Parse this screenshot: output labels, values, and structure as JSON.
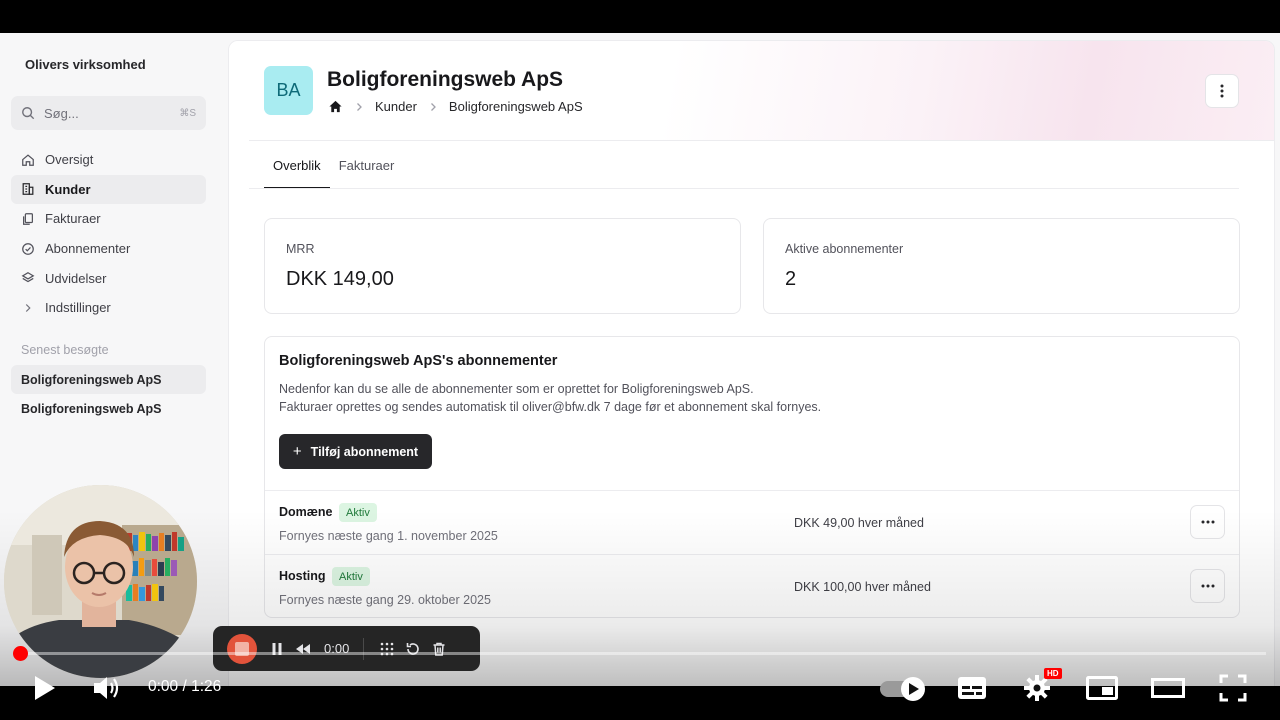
{
  "sidebar": {
    "org_name": "Olivers virksomhed",
    "search_placeholder": "Søg...",
    "search_shortcut": "⌘S",
    "items": [
      {
        "label": "Oversigt",
        "icon": "home-icon"
      },
      {
        "label": "Kunder",
        "icon": "building-icon",
        "active": true
      },
      {
        "label": "Fakturaer",
        "icon": "documents-icon"
      },
      {
        "label": "Abonnementer",
        "icon": "check-circle-icon"
      },
      {
        "label": "Udvidelser",
        "icon": "layers-icon"
      },
      {
        "label": "Indstillinger",
        "icon": "chevron-right-icon"
      }
    ],
    "recent_heading": "Senest besøgte",
    "recent": [
      "Boligforeningsweb ApS",
      "Boligforeningsweb ApS"
    ]
  },
  "header": {
    "avatar_initials": "BA",
    "title": "Boligforeningsweb ApS",
    "breadcrumb": [
      "Kunder",
      "Boligforeningsweb ApS"
    ]
  },
  "tabs": [
    "Overblik",
    "Fakturaer"
  ],
  "stats": {
    "mrr_label": "MRR",
    "mrr_value": "DKK 149,00",
    "active_label": "Aktive abonnementer",
    "active_value": "2"
  },
  "subscriptions": {
    "title": "Boligforeningsweb ApS's abonnementer",
    "desc_line1": "Nedenfor kan du se alle de abonnementer som er oprettet for Boligforeningsweb ApS.",
    "desc_line2": "Fakturaer oprettes og sendes automatisk til oliver@bfw.dk 7 dage før et abonnement skal fornyes.",
    "add_button": "Tilføj abonnement",
    "rows": [
      {
        "name": "Domæne",
        "status": "Aktiv",
        "renews": "Fornyes næste gang 1. november 2025",
        "price": "DKK 49,00 hver måned"
      },
      {
        "name": "Hosting",
        "status": "Aktiv",
        "renews": "Fornyes næste gang 29. oktober 2025",
        "price": "DKK 100,00 hver måned"
      }
    ]
  },
  "recorder": {
    "time": "0:00"
  },
  "player": {
    "time": "0:00 / 1:26",
    "quality_badge": "HD",
    "progress": 0.0
  },
  "colors": {
    "avatar_bg": "#a9ecf1",
    "badge_bg": "#dcf5e2",
    "badge_text": "#1f7a3a",
    "primary_button": "#27272a",
    "progress_accent": "#ff0000",
    "record_stop": "#e2533b"
  }
}
